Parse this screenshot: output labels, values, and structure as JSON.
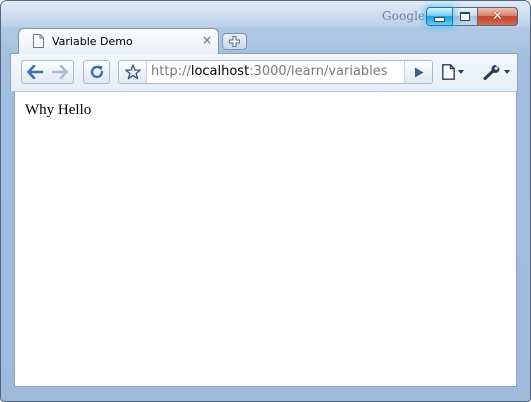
{
  "window": {
    "brand": "Google",
    "controls": {
      "minimize": "minimize",
      "maximize": "maximize",
      "close": "close"
    }
  },
  "tabs": [
    {
      "title": "Variable Demo",
      "icon": "page-icon",
      "close_glyph": "×",
      "active": true
    }
  ],
  "toolbar": {
    "back_icon": "back-arrow-icon",
    "forward_icon": "forward-arrow-icon",
    "reload_icon": "reload-icon",
    "bookmark_icon": "star-icon",
    "go_icon": "play-icon",
    "page_menu_icon": "page-menu-icon",
    "tools_menu_icon": "wrench-icon"
  },
  "address_bar": {
    "scheme": "http://",
    "host": "localhost",
    "rest": ":3000/learn/variables"
  },
  "page": {
    "body_text": "Why Hello"
  },
  "colors": {
    "frame": "#a3bfdf",
    "minimize_glow": "#3cc8ff",
    "close": "#c0452b",
    "nav_arrow": "#3f6fae"
  }
}
